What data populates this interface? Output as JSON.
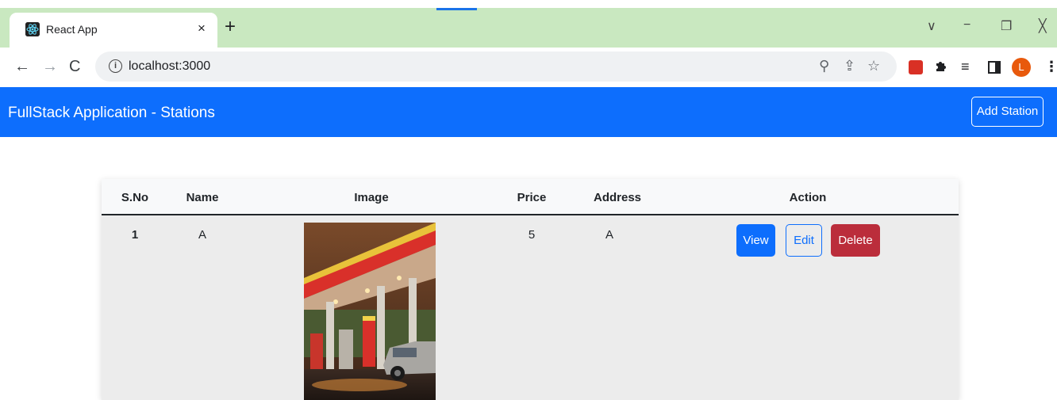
{
  "browser": {
    "tab": {
      "title": "React App",
      "close_glyph": "×",
      "favicon": "react-logo-icon"
    },
    "new_tab_glyph": "+",
    "window_controls": {
      "dropdown": "∨",
      "minimize": "−",
      "restore": "❐",
      "close": "╳"
    },
    "nav": {
      "back": "←",
      "forward": "→",
      "reload": "C"
    },
    "address": {
      "info_glyph": "i",
      "url": "localhost:3000"
    },
    "omnibox_icons": {
      "zoom": "⚲",
      "share": "⇪",
      "bookmark": "☆"
    },
    "extensions": {
      "queue": "≡",
      "avatar_letter": "L",
      "menu": "⋮"
    }
  },
  "navbar": {
    "brand": "FullStack Application - Stations",
    "add_button": "Add Station"
  },
  "table": {
    "headers": {
      "sno": "S.No",
      "name": "Name",
      "image": "Image",
      "price": "Price",
      "address": "Address",
      "action": "Action"
    },
    "rows": [
      {
        "sno": "1",
        "name": "A",
        "price": "5",
        "address": "A"
      }
    ],
    "actions": {
      "view": "View",
      "edit": "Edit",
      "delete": "Delete"
    }
  },
  "colors": {
    "tabstrip": "#c9e8c0",
    "navbar": "#0d6efd",
    "view_button": "#0d6efd",
    "delete_button": "#bb2d3b"
  }
}
